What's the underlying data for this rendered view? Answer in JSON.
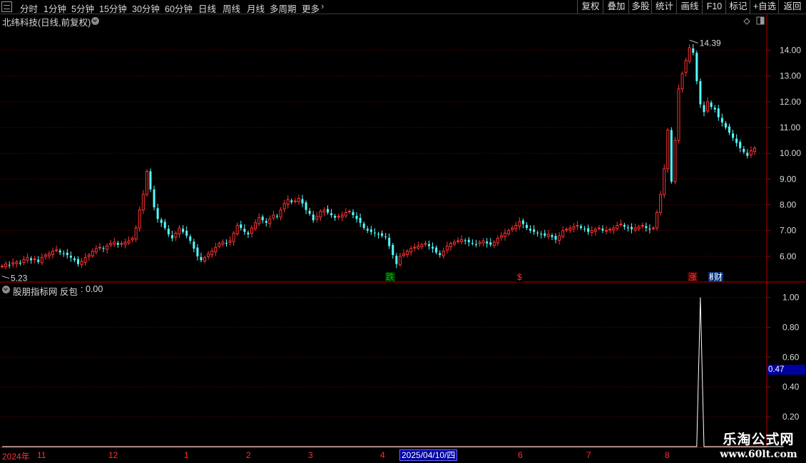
{
  "toolbar": {
    "periods": [
      "分时",
      "1分钟",
      "5分钟",
      "15分钟",
      "30分钟",
      "60分钟",
      "日线",
      "周线",
      "月线",
      "多周期",
      "更多"
    ],
    "active_period": "日线",
    "right_buttons": [
      "复权",
      "叠加",
      "多股",
      "统计",
      "画线",
      "F10",
      "标记",
      "+自选",
      "返回"
    ]
  },
  "chart": {
    "title": "北纬科技(日线,前复权)",
    "high_label": "14.39",
    "low_label": "5.23",
    "badges": [
      {
        "text": "跌",
        "color": "#00c000",
        "bg": "#003000"
      },
      {
        "text": "$",
        "color": "#ff3030",
        "bg": "#000000"
      },
      {
        "text": "涨",
        "color": "#ff4040",
        "bg": "#400000"
      },
      {
        "text": "概",
        "color": "#ffffff",
        "bg": "#003080"
      },
      {
        "text": "财",
        "color": "#ffffff",
        "bg": "#003080"
      }
    ],
    "colors": {
      "up": "#ff3232",
      "down": "#54ffff",
      "grid": "#8b0000",
      "axis": "#b00000",
      "label": "#d8d8d8"
    }
  },
  "indicator": {
    "title": "股朋指标网 反包",
    "value_text": ": 0.00",
    "cursor_value": "0.47"
  },
  "timeline": {
    "labels": [
      "2024年",
      "11",
      "12",
      "1",
      "2",
      "3",
      "4",
      "6",
      "7",
      "8"
    ],
    "highlight_date": "2025/04/10/四"
  },
  "watermark": {
    "title": "乐淘公式网",
    "url": "www.60lt.com"
  },
  "chart_data": [
    {
      "type": "candlestick",
      "title": "北纬科技(日线,前复权)",
      "y_ticks": [
        6.0,
        7.0,
        8.0,
        9.0,
        10.0,
        11.0,
        12.0,
        13.0,
        14.0
      ],
      "ylim": [
        5.0,
        14.9
      ],
      "annotations": [
        {
          "text": "14.39",
          "value": 14.39
        },
        {
          "text": "5.23",
          "value": 5.23
        }
      ],
      "close": [
        5.62,
        5.7,
        5.66,
        5.75,
        5.78,
        5.72,
        5.88,
        5.95,
        5.85,
        5.9,
        5.78,
        5.95,
        6.05,
        6.1,
        6.2,
        6.25,
        6.15,
        6.1,
        6.05,
        5.95,
        5.85,
        5.7,
        5.8,
        5.95,
        6.05,
        6.2,
        6.3,
        6.35,
        6.3,
        6.4,
        6.5,
        6.55,
        6.45,
        6.5,
        6.55,
        6.6,
        6.7,
        7.1,
        7.8,
        8.4,
        9.3,
        8.6,
        7.9,
        7.45,
        7.3,
        7.1,
        6.85,
        6.7,
        6.9,
        7.1,
        6.95,
        6.8,
        6.6,
        6.3,
        6.0,
        5.85,
        5.95,
        6.1,
        6.2,
        6.35,
        6.5,
        6.55,
        6.5,
        6.6,
        6.9,
        7.2,
        7.1,
        6.95,
        6.85,
        7.1,
        7.3,
        7.5,
        7.4,
        7.3,
        7.45,
        7.6,
        7.55,
        7.8,
        8.05,
        8.2,
        8.1,
        8.15,
        8.25,
        8.05,
        7.8,
        7.65,
        7.4,
        7.55,
        7.75,
        7.8,
        7.7,
        7.6,
        7.5,
        7.55,
        7.6,
        7.7,
        7.75,
        7.6,
        7.45,
        7.3,
        7.1,
        7.0,
        6.95,
        6.9,
        6.85,
        6.8,
        6.75,
        6.4,
        6.05,
        5.7,
        6.0,
        6.1,
        6.2,
        6.3,
        6.35,
        6.4,
        6.45,
        6.5,
        6.4,
        6.3,
        6.15,
        6.05,
        6.2,
        6.4,
        6.5,
        6.55,
        6.6,
        6.65,
        6.6,
        6.55,
        6.5,
        6.45,
        6.55,
        6.6,
        6.5,
        6.45,
        6.55,
        6.7,
        6.8,
        6.9,
        7.0,
        7.1,
        7.2,
        7.35,
        7.25,
        7.1,
        7.0,
        6.95,
        6.9,
        6.85,
        6.8,
        6.85,
        6.75,
        6.65,
        6.8,
        7.0,
        7.05,
        7.1,
        7.15,
        7.2,
        7.1,
        7.05,
        6.95,
        7.0,
        7.05,
        7.1,
        7.0,
        7.0,
        7.05,
        7.1,
        7.2,
        7.25,
        7.15,
        7.1,
        7.05,
        7.1,
        7.15,
        7.2,
        7.1,
        7.05,
        7.1,
        7.7,
        8.4,
        9.4,
        10.9,
        8.9,
        10.5,
        12.5,
        13.1,
        13.6,
        14.1,
        13.9,
        12.8,
        11.9,
        11.6,
        12.0,
        11.8,
        11.7,
        11.4,
        11.2,
        11.0,
        10.8,
        10.6,
        10.4,
        10.2,
        10.05,
        9.9,
        10.1,
        10.2
      ]
    },
    {
      "type": "line",
      "title": "股朋指标网 反包",
      "y_ticks": [
        0.2,
        0.4,
        0.6,
        0.8,
        1.0
      ],
      "ylim": [
        0.0,
        1.05
      ],
      "values": [
        0,
        0,
        0,
        0,
        0,
        0,
        0,
        0,
        0,
        0,
        0,
        0,
        0,
        0,
        0,
        0,
        0,
        0,
        0,
        0,
        0,
        0,
        0,
        0,
        0,
        0,
        0,
        0,
        0,
        0,
        0,
        0,
        0,
        0,
        0,
        0,
        0,
        0,
        0,
        0,
        0,
        0,
        0,
        0,
        0,
        0,
        0,
        0,
        0,
        0,
        0,
        0,
        0,
        0,
        0,
        0,
        0,
        0,
        0,
        0,
        0,
        0,
        0,
        0,
        0,
        0,
        0,
        0,
        0,
        0,
        0,
        0,
        0,
        0,
        0,
        0,
        0,
        0,
        0,
        0,
        0,
        0,
        0,
        0,
        0,
        0,
        0,
        0,
        0,
        0,
        0,
        0,
        0,
        0,
        0,
        0,
        0,
        0,
        0,
        0,
        0,
        0,
        0,
        0,
        0,
        0,
        0,
        0,
        0,
        0,
        0,
        0,
        0,
        0,
        0,
        0,
        0,
        0,
        0,
        0,
        0,
        0,
        0,
        0,
        0,
        0,
        0,
        0,
        0,
        0,
        0,
        0,
        0,
        0,
        0,
        0,
        0,
        0,
        0,
        0,
        0,
        0,
        0,
        0,
        0,
        0,
        0,
        0,
        0,
        0,
        0,
        0,
        0,
        0,
        0,
        0,
        0,
        0,
        0,
        0,
        0,
        0,
        0,
        0,
        0,
        0,
        0,
        0,
        0,
        0,
        0,
        0,
        0,
        0,
        0,
        0,
        0,
        0,
        0,
        0,
        0,
        0,
        0,
        0,
        0,
        0,
        0,
        0,
        0,
        0,
        0,
        0,
        0,
        1,
        0,
        0,
        0,
        0,
        0,
        0,
        0,
        0,
        0,
        0,
        0,
        0,
        0,
        0,
        0,
        0,
        0,
        0,
        0,
        0,
        0,
        0,
        0
      ]
    }
  ]
}
